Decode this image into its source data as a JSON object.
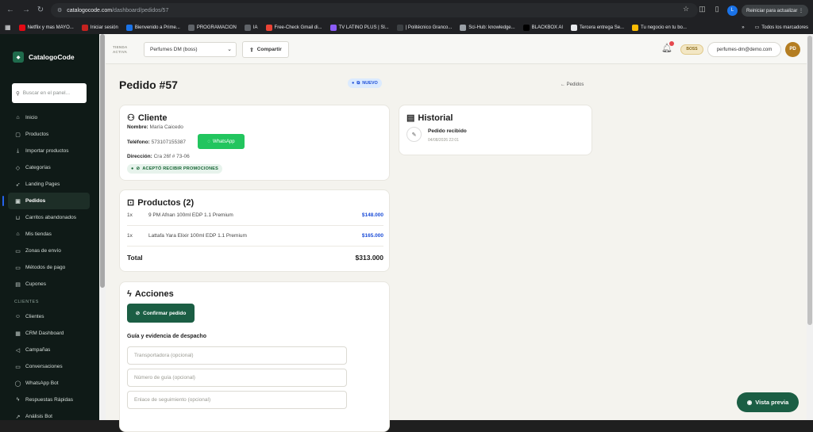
{
  "browser": {
    "url_host": "catalogocode.com",
    "url_path": "/dashboard/pedidos/57",
    "relaunch_label": "Reiniciar para actualizar",
    "profile_initial": "L",
    "bookmarks": [
      {
        "label": "Netflix y mas MAYO...",
        "color": "#e50914"
      },
      {
        "label": "Iniciar sesión",
        "color": "#c5221f"
      },
      {
        "label": "Bienvenido a Prime...",
        "color": "#1a73e8"
      },
      {
        "label": "PROGRAMACION",
        "color": "#5f6368"
      },
      {
        "label": "IA",
        "color": "#5f6368"
      },
      {
        "label": "Free-Check Gmail di...",
        "color": "#ea4335"
      },
      {
        "label": "TV LATINO PLUS | Sl...",
        "color": "#8b5cf6"
      },
      {
        "label": "| Politécnico Granco...",
        "color": "#3c4043"
      },
      {
        "label": "Sci-Hub: knowledge...",
        "color": "#9aa0a6"
      },
      {
        "label": "BLACKBOX AI",
        "color": "#000000"
      },
      {
        "label": "Tercera entrega Se...",
        "color": "#e8eaed"
      },
      {
        "label": "Tu negocio en tu bo...",
        "color": "#fbbc04"
      }
    ],
    "all_bookmarks": "Todos los marcadores"
  },
  "sidebar": {
    "brand": "CatalogoCode",
    "search_placeholder": "Buscar en el panel...",
    "items": [
      {
        "label": "Inicio",
        "icon": "⌂"
      },
      {
        "label": "Productos",
        "icon": "▢"
      },
      {
        "label": "Importar productos",
        "icon": "⤓"
      },
      {
        "label": "Categorías",
        "icon": "◇"
      },
      {
        "label": "Landing Pages",
        "icon": "➶"
      },
      {
        "label": "Pedidos",
        "icon": "▣",
        "active": true
      },
      {
        "label": "Carritos abandonados",
        "icon": "⊔"
      },
      {
        "label": "Mis tiendas",
        "icon": "⌂"
      },
      {
        "label": "Zonas de envío",
        "icon": "▭"
      },
      {
        "label": "Métodos de pago",
        "icon": "▭"
      },
      {
        "label": "Cupones",
        "icon": "▤"
      }
    ],
    "section_clientes": "CLIENTES",
    "items2": [
      {
        "label": "Clientes",
        "icon": "☺"
      },
      {
        "label": "CRM Dashboard",
        "icon": "▦"
      },
      {
        "label": "Campañas",
        "icon": "◁"
      },
      {
        "label": "Conversaciones",
        "icon": "▭"
      },
      {
        "label": "WhatsApp Bot",
        "icon": "◯"
      },
      {
        "label": "Respuestas Rápidas",
        "icon": "ϟ"
      },
      {
        "label": "Análisis Bot",
        "icon": "↗"
      }
    ]
  },
  "topbar": {
    "store_label_1": "TIENDA",
    "store_label_2": "ACTIVA",
    "store_selected": "Perfumes DM (boss)",
    "share_label": "Compartir",
    "role_badge": "BOSS",
    "email": "perfumes-dm@demo.com",
    "user_initials": "PD"
  },
  "order": {
    "title": "Pedido #57",
    "status": "NUEVO",
    "back_label": "← Pedidos",
    "client": {
      "heading": "Cliente",
      "name_label": "Nombre:",
      "name": "María Caicedo",
      "phone_label": "Teléfono:",
      "phone": "573107155387",
      "whatsapp_label": "WhatsApp",
      "address_label": "Dirección:",
      "address": "Cra 26f # 73-06",
      "promo_badge": "ACEPTÓ RECIBIR PROMOCIONES"
    },
    "products": {
      "heading": "Productos (2)",
      "items": [
        {
          "qty": "1x",
          "name": "9 PM Afnan 100ml EDP 1.1 Premium",
          "price": "$148.000"
        },
        {
          "qty": "1x",
          "name": "Lattafa Yara Elixir 100ml EDP 1.1 Premium",
          "price": "$165.000"
        }
      ],
      "total_label": "Total",
      "total": "$313.000"
    },
    "actions": {
      "heading": "Acciones",
      "confirm_label": "Confirmar pedido",
      "dispatch_label": "Guía y evidencia de despacho",
      "carrier_placeholder": "Transportadora (opcional)",
      "guide_placeholder": "Número de guía (opcional)",
      "tracking_placeholder": "Enlace de seguimiento (opcional)"
    },
    "history": {
      "heading": "Historial",
      "event": "Pedido recibido",
      "date": "04/08/2026 22:01"
    }
  },
  "preview_label": "Vista previa"
}
